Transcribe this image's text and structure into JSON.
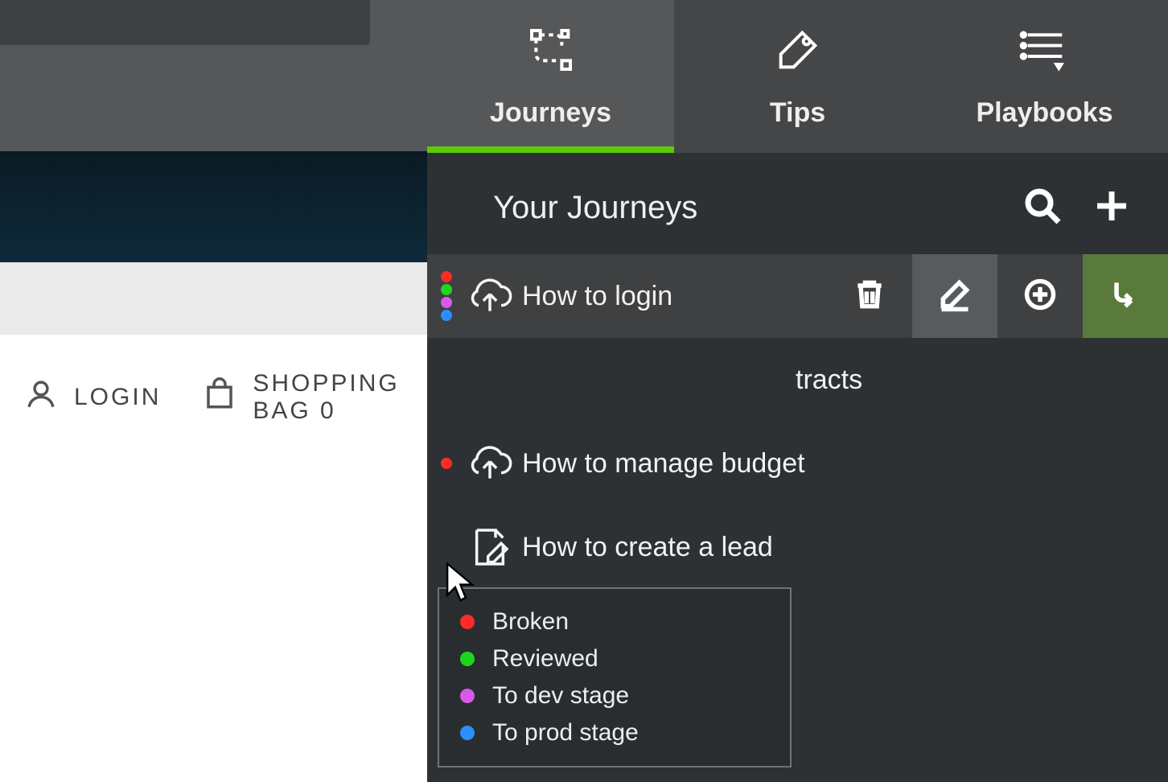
{
  "background_app": {
    "login_label": "LOGIN",
    "bag_label": "SHOPPING BAG 0"
  },
  "tabs": [
    {
      "label": "Journeys",
      "active": true
    },
    {
      "label": "Tips",
      "active": false
    },
    {
      "label": "Playbooks",
      "active": false
    }
  ],
  "section": {
    "title": "Your Journeys"
  },
  "status_legend": [
    {
      "color": "red",
      "label": "Broken"
    },
    {
      "color": "green",
      "label": "Reviewed"
    },
    {
      "color": "pink",
      "label": "To dev stage"
    },
    {
      "color": "blue",
      "label": "To prod stage"
    }
  ],
  "journeys": [
    {
      "label": "How to login",
      "icon": "cloud-upload",
      "dots": [
        "red",
        "green",
        "pink",
        "blue"
      ],
      "selected": true
    },
    {
      "label": "tracts",
      "icon": "",
      "dots": []
    },
    {
      "label": "How to manage budget",
      "icon": "cloud-upload",
      "dots": [
        "red"
      ]
    },
    {
      "label": "How to create a lead",
      "icon": "edit-doc",
      "dots": []
    }
  ]
}
